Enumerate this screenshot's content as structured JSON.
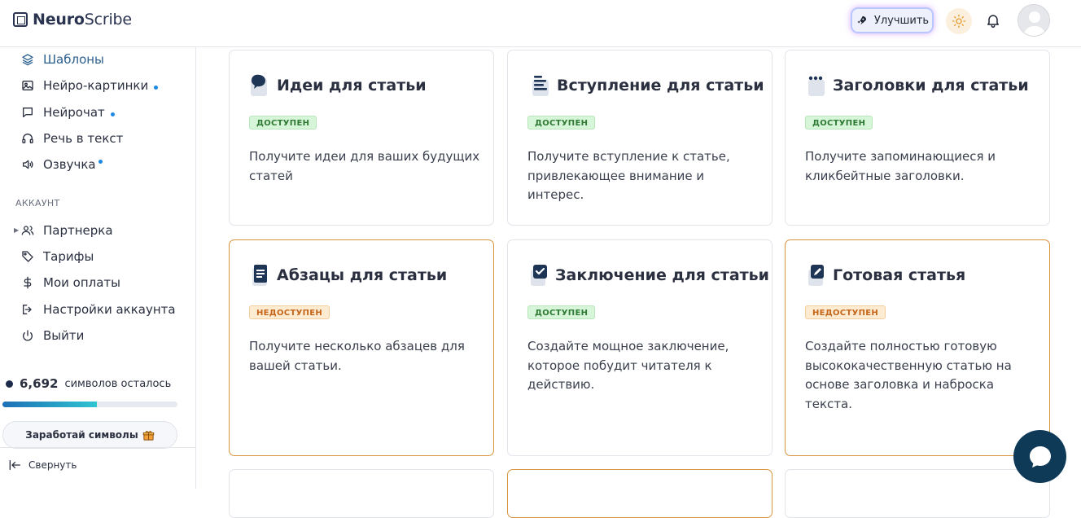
{
  "header": {
    "logo_bold": "Neuro",
    "logo_rest": "Scribe",
    "upgrade_label": "Улучшить"
  },
  "sidebar": {
    "items": [
      {
        "label": "Шаблоны",
        "icon": "layers-icon",
        "dot": false,
        "active": true
      },
      {
        "label": "Нейро-картинки",
        "icon": "image-icon",
        "dot": true
      },
      {
        "label": "Нейрочат",
        "icon": "chat-icon",
        "dot": true
      },
      {
        "label": "Речь в текст",
        "icon": "headphones-icon",
        "dot": false
      },
      {
        "label": "Озвучка",
        "icon": "speaker-icon",
        "dot": true
      }
    ],
    "account_label": "АККАУНТ",
    "account_items": [
      {
        "label": "Партнерка",
        "icon": "users-icon"
      },
      {
        "label": "Тарифы",
        "icon": "tag-icon"
      },
      {
        "label": "Мои оплаты",
        "icon": "dollar-icon"
      },
      {
        "label": "Настройки аккаунта",
        "icon": "logout-arrow-icon"
      },
      {
        "label": "Выйти",
        "icon": "power-icon"
      }
    ],
    "credits_value": "6,692",
    "credits_text": "символов осталось",
    "credits_fraction": 0.54,
    "earn_label": "Заработай символы",
    "collapse_label": "Свернуть"
  },
  "cards": [
    {
      "title": "Идеи для статьи",
      "badge": "ДОСТУПЕН",
      "desc": "Получите идеи для ваших будущих статей",
      "icon": "speech-bubble-icon"
    },
    {
      "title": "Вступление для статьи",
      "badge": "ДОСТУПЕН",
      "desc": "Получите вступление к статье, привлекающее внимание и интерес.",
      "icon": "text-lines-icon"
    },
    {
      "title": "Заголовки для статьи",
      "badge": "ДОСТУПЕН",
      "desc": "Получите запоминающиеся и кликбейтные заголовки.",
      "icon": "dots-card-icon"
    },
    {
      "title": "Абзацы для статьи",
      "badge": "НЕДОСТУПЕН",
      "desc": "Получите несколько абзацев для вашей статьи.",
      "icon": "notebook-icon"
    },
    {
      "title": "Заключение для статьи",
      "badge": "ДОСТУПЕН",
      "desc": "Создайте мощное заключение, которое побудит читателя к действию.",
      "icon": "checkbox-icon"
    },
    {
      "title": "Готовая статья",
      "badge": "НЕДОСТУПЕН",
      "desc": "Создайте полностью готовую высококачественную статью на основе заголовка и наброска текста.",
      "icon": "pencil-doc-icon"
    }
  ],
  "colors": {
    "brand": "#2a3350",
    "accent": "#2b5f8f",
    "available_bg": "#d7f5d8",
    "locked_bg": "#fdecd2",
    "locked_border": "#d9933d",
    "chat_fab": "#0e3a58"
  }
}
